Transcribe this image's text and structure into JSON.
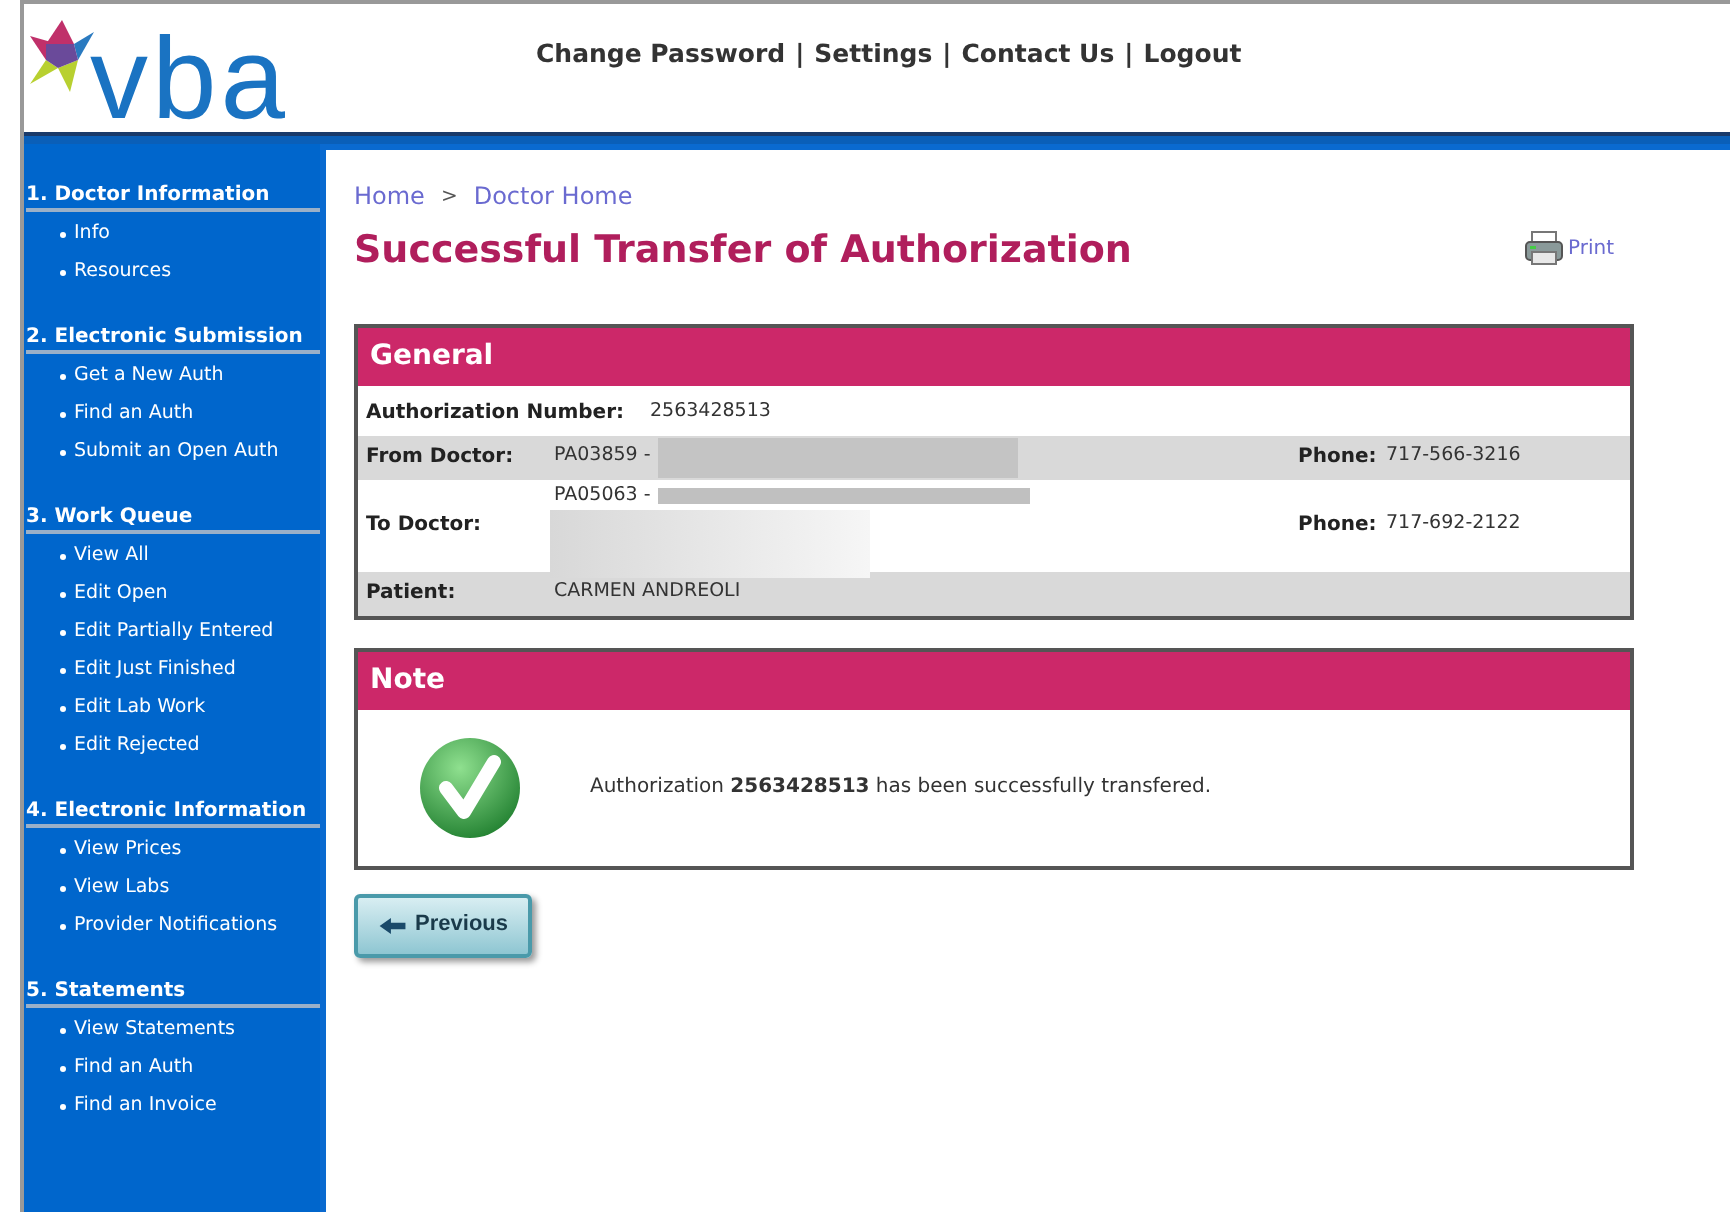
{
  "header": {
    "logo": "vba",
    "links": [
      "Change Password",
      "Settings",
      "Contact Us",
      "Logout"
    ],
    "separator": "|"
  },
  "sidebar": {
    "sections": [
      {
        "title": "1. Doctor Information",
        "items": [
          "Info",
          "Resources"
        ]
      },
      {
        "title": "2. Electronic Submission",
        "items": [
          "Get a New Auth",
          "Find an Auth",
          "Submit an Open Auth"
        ]
      },
      {
        "title": "3. Work Queue",
        "items": [
          "View All",
          "Edit Open",
          "Edit Partially Entered",
          "Edit Just Finished",
          "Edit Lab Work",
          "Edit Rejected"
        ]
      },
      {
        "title": "4. Electronic Information",
        "items": [
          "View Prices",
          "View Labs",
          "Provider Notifications"
        ]
      },
      {
        "title": "5. Statements",
        "items": [
          "View Statements",
          "Find an Auth",
          "Find an Invoice"
        ]
      }
    ]
  },
  "breadcrumb": [
    "Home",
    "Doctor Home"
  ],
  "breadcrumb_separator": ">",
  "title": "Successful Transfer of Authorization",
  "print": "Print",
  "general": {
    "heading": "General",
    "rows": [
      {
        "label": "Authorization Number:",
        "value": "2563428513",
        "redacted": false,
        "shaded": false
      },
      {
        "label": "From Doctor:",
        "value": "PA03859 -",
        "redacted": true,
        "shaded": true,
        "phone_label": "Phone:",
        "phone": "717-566-3216"
      },
      {
        "label": "To Doctor:",
        "value": "PA05063 -",
        "redacted": true,
        "shaded": false,
        "phone_label": "Phone:",
        "phone": "717-692-2122"
      },
      {
        "label": "Patient:",
        "value": "CARMEN ANDREOLI",
        "redacted": false,
        "shaded": true
      }
    ]
  },
  "note": {
    "heading": "Note",
    "message": "Authorization **2563428513** has been successfully transfered."
  },
  "previous_button": "Previous"
}
